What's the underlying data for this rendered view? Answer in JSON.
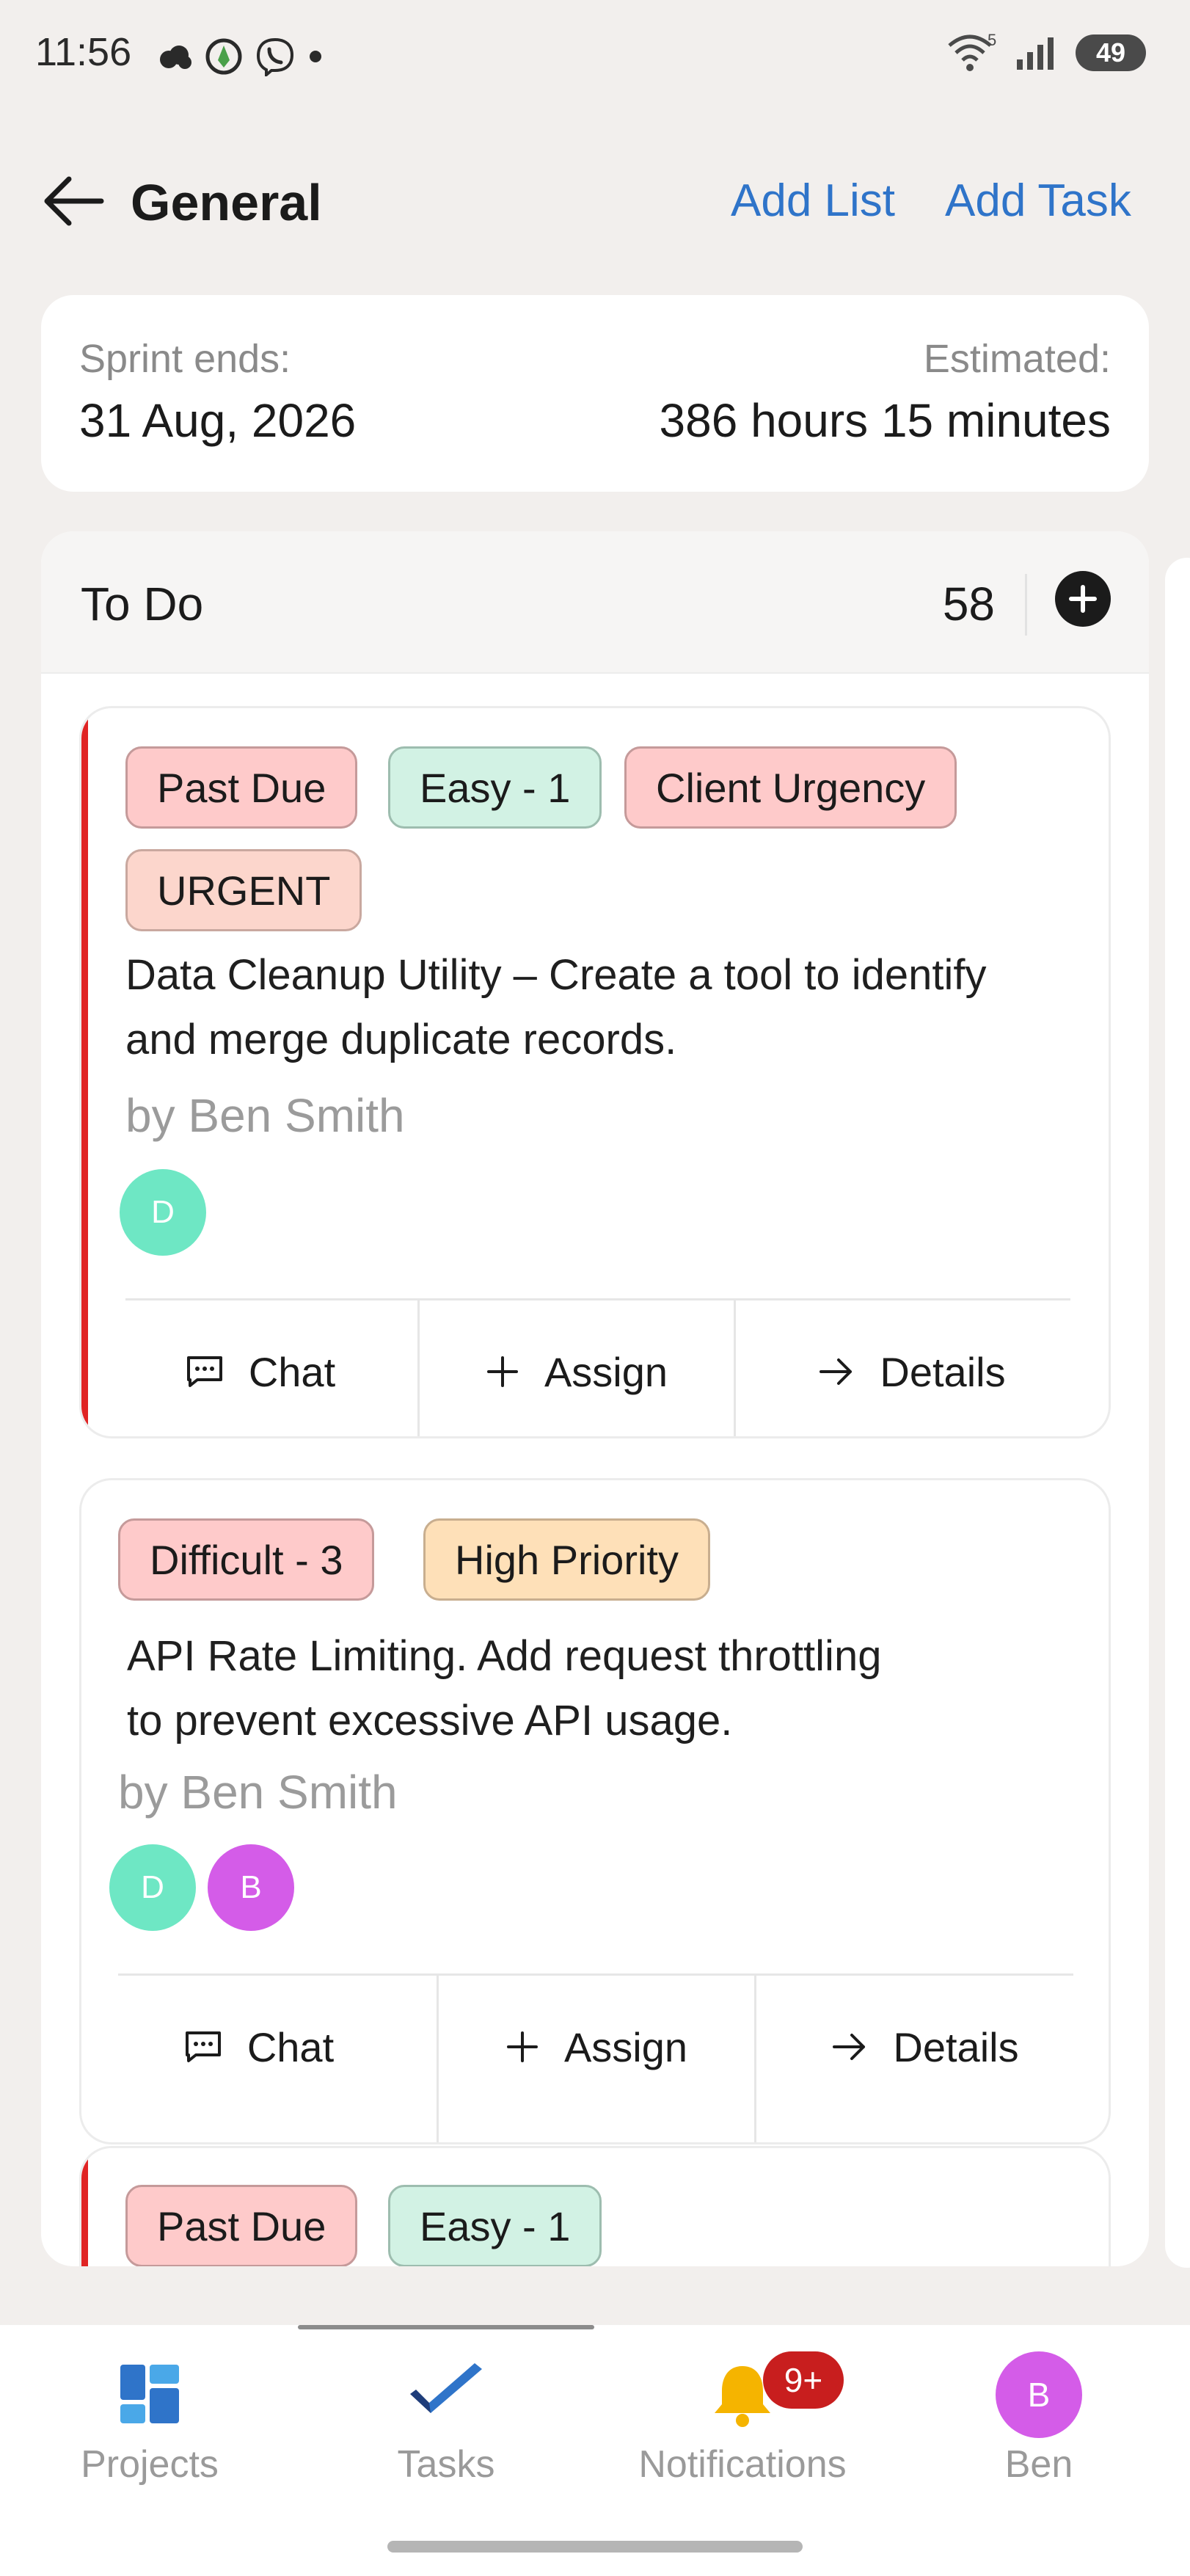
{
  "status_bar": {
    "time": "11:56",
    "battery": "49",
    "wifi_label": "5"
  },
  "header": {
    "title": "General",
    "add_list": "Add List",
    "add_task": "Add Task"
  },
  "sprint": {
    "ends_label": "Sprint ends:",
    "ends_value": "31 Aug, 2026",
    "estimated_label": "Estimated:",
    "estimated_value": "386 hours 15 minutes"
  },
  "list": {
    "title": "To Do",
    "count": "58"
  },
  "tasks": [
    {
      "tags": [
        "Past Due",
        "Easy - 1",
        "Client Urgency",
        "URGENT"
      ],
      "title_line1": "Data Cleanup Utility – Create a tool to identify",
      "title_line2": "and merge duplicate records.",
      "author": "by Ben Smith",
      "avatars": [
        "D"
      ],
      "actions": [
        "Chat",
        "Assign",
        "Details"
      ]
    },
    {
      "tags": [
        "Difficult - 3",
        "High Priority"
      ],
      "title_line1": "API Rate Limiting. Add request throttling",
      "title_line2": "to prevent excessive API usage.",
      "author": "by Ben Smith",
      "avatars": [
        "D",
        "B"
      ],
      "actions": [
        "Chat",
        "Assign",
        "Details"
      ]
    },
    {
      "tags": [
        "Past Due",
        "Easy - 1"
      ]
    }
  ],
  "bottom_nav": {
    "projects": "Projects",
    "tasks": "Tasks",
    "notifications": "Notifications",
    "notifications_badge": "9+",
    "profile": "Ben",
    "profile_initial": "B"
  },
  "colors": {
    "accent": "#2f74c9",
    "urgent": "#e02424",
    "avatar_d": "#6ee7c4",
    "avatar_b": "#d45ce8",
    "badge": "#c81e1e"
  }
}
